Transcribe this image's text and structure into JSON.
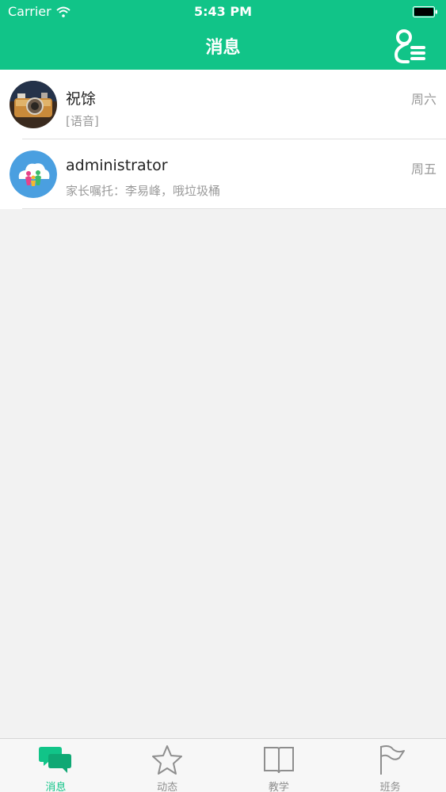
{
  "status_bar": {
    "carrier": "Carrier",
    "time": "5:43 PM"
  },
  "header": {
    "title": "消息",
    "right_icon": "contacts-menu-icon",
    "color": "#11c488"
  },
  "conversations": [
    {
      "name": "祝馀",
      "preview": "[语音]",
      "day": "周六",
      "avatar": "camera-photo"
    },
    {
      "name": "administrator",
      "preview": "家长嘱托：李易峰，哦垃圾桶",
      "day": "周五",
      "avatar": "cloud-family-logo"
    }
  ],
  "tabbar": {
    "active_color": "#11c488",
    "items": [
      {
        "label": "消息",
        "icon": "chat-bubbles-icon",
        "active": true
      },
      {
        "label": "动态",
        "icon": "star-icon",
        "active": false
      },
      {
        "label": "教学",
        "icon": "book-icon",
        "active": false
      },
      {
        "label": "班务",
        "icon": "flag-icon",
        "active": false
      }
    ]
  }
}
